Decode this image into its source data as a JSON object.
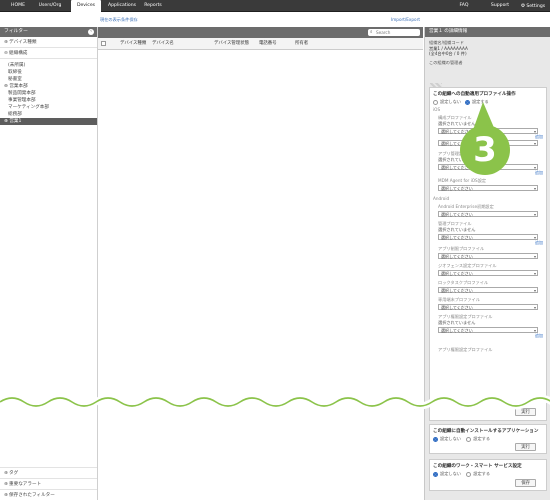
{
  "nav": {
    "items": [
      "HOME",
      "Users/Org",
      "Devices",
      "Applications",
      "Reports"
    ],
    "right": [
      "FAQ",
      "Support",
      "Settings"
    ],
    "active": "Devices"
  },
  "main": {
    "top_link_left": "現在の表示条件保存",
    "top_link_right": "Import/Export",
    "search_placeholder": "Search",
    "columns": [
      "デバイス種類",
      "デバイス名",
      "デバイス管理状態",
      "電話番号",
      "所有者"
    ]
  },
  "sidebar": {
    "header": "フィルター",
    "rows": [
      {
        "icon": "plus",
        "label": "デバイス種類"
      },
      {
        "icon": "minus",
        "label": "組織構成"
      }
    ],
    "tree": [
      {
        "label": "(未所属)",
        "indent": 1
      },
      {
        "label": "取締役",
        "indent": 1
      },
      {
        "label": "秘書室",
        "indent": 1
      },
      {
        "label": "営業本部",
        "indent": 0,
        "toggle": "minus"
      },
      {
        "label": "製品開発本部",
        "indent": 1
      },
      {
        "label": "事業管理本部",
        "indent": 1
      },
      {
        "label": "マーケティング本部",
        "indent": 1
      },
      {
        "label": "総務部",
        "indent": 1
      },
      {
        "label": "営業1",
        "indent": 0,
        "toggle": "plus",
        "selected": true
      }
    ],
    "bottom": [
      {
        "icon": "plus",
        "label": "タグ"
      },
      {
        "icon": "plus",
        "label": "重要なアラート"
      },
      {
        "icon": "plus",
        "label": "保存されたフィルター"
      }
    ]
  },
  "rpanel": {
    "header": "営業１ の詳細情報",
    "info_lines": [
      "組織名/組織コード",
      "営業1 / AAAAAAAA",
      "(全4台中0台 / 0 件)",
      "この組織の管理者"
    ],
    "profile_box": {
      "title": "この組織への自動適用プロファイル操作",
      "radio": [
        {
          "label": "設定しない",
          "on": false
        },
        {
          "label": "設定する",
          "on": true
        }
      ],
      "groups": [
        {
          "section": "iOS",
          "items": [
            {
              "label": "構成プロファイル",
              "status": "選択されていません",
              "select": "選択してください",
              "add": "追加"
            },
            {
              "label": "アプリ管理設定",
              "status": "選択されていません",
              "select": "選択してください",
              "add": "追加"
            },
            {
              "label": "MDM Agent for iOS設定",
              "status": "",
              "select": "選択してください",
              "add": ""
            }
          ]
        },
        {
          "section": "Android",
          "items": [
            {
              "label": "Android Enterprise初期設定",
              "status": "",
              "select": "選択してください",
              "add": ""
            },
            {
              "label": "管理プロファイル",
              "status": "選択されていません",
              "select": "選択してください",
              "add": "追加"
            },
            {
              "label": "アプリ制限プロファイル",
              "status": "",
              "select": "選択してください",
              "add": ""
            },
            {
              "label": "ジオフェンス設定プロファイル",
              "status": "",
              "select": "選択してください",
              "add": ""
            },
            {
              "label": "ロックタスクプロファイル",
              "status": "",
              "select": "選択してください",
              "add": ""
            },
            {
              "label": "専用端末プロファイル",
              "status": "",
              "select": "選択してください",
              "add": ""
            },
            {
              "label": "アプリ権限設定プロファイル",
              "status": "選択されていません",
              "select": "選択してください",
              "add": "追加"
            },
            {
              "label": "アプリ権限設定プロファイル",
              "status": "",
              "select": "",
              "add": ""
            }
          ]
        }
      ],
      "execute": "実行"
    },
    "app_box": {
      "title": "この組織に自動インストールするアプリケーション",
      "radio": [
        {
          "label": "設定しない",
          "on": true
        },
        {
          "label": "設定する",
          "on": false
        }
      ],
      "execute": "実行"
    },
    "work_box": {
      "title": "この組織のワーク・スマート サービス設定",
      "radio": [
        {
          "label": "設定しない",
          "on": true
        },
        {
          "label": "設定する",
          "on": false
        }
      ],
      "save": "保存"
    }
  },
  "badge": {
    "number": "3",
    "color": "#8bc34a"
  }
}
